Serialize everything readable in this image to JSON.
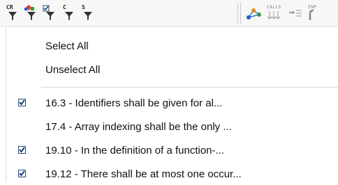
{
  "toolbar": {
    "buttons": [
      {
        "glyph": "CR",
        "name": "filter-cr"
      },
      {
        "glyph": "",
        "name": "filter-color"
      },
      {
        "glyph": "",
        "name": "filter-check"
      },
      {
        "glyph": "C",
        "name": "filter-c"
      },
      {
        "glyph": "S",
        "name": "filter-s"
      }
    ],
    "calls_label": "CALLS",
    "inp_label": "INP"
  },
  "menu": {
    "select_all": "Select All",
    "unselect_all": "Unselect All",
    "rules": [
      {
        "label": "16.3 - Identifiers shall be given for al...",
        "checked": true
      },
      {
        "label": "17.4 - Array indexing shall be the only ...",
        "checked": false
      },
      {
        "label": "19.10 - In the definition of a function-...",
        "checked": true
      },
      {
        "label": "19.12 - There shall be at most one occur...",
        "checked": true
      }
    ]
  },
  "colors": {
    "check_border": "#2b4a7a",
    "check_mark": "#1b3f7a",
    "funnel": "#333333"
  }
}
